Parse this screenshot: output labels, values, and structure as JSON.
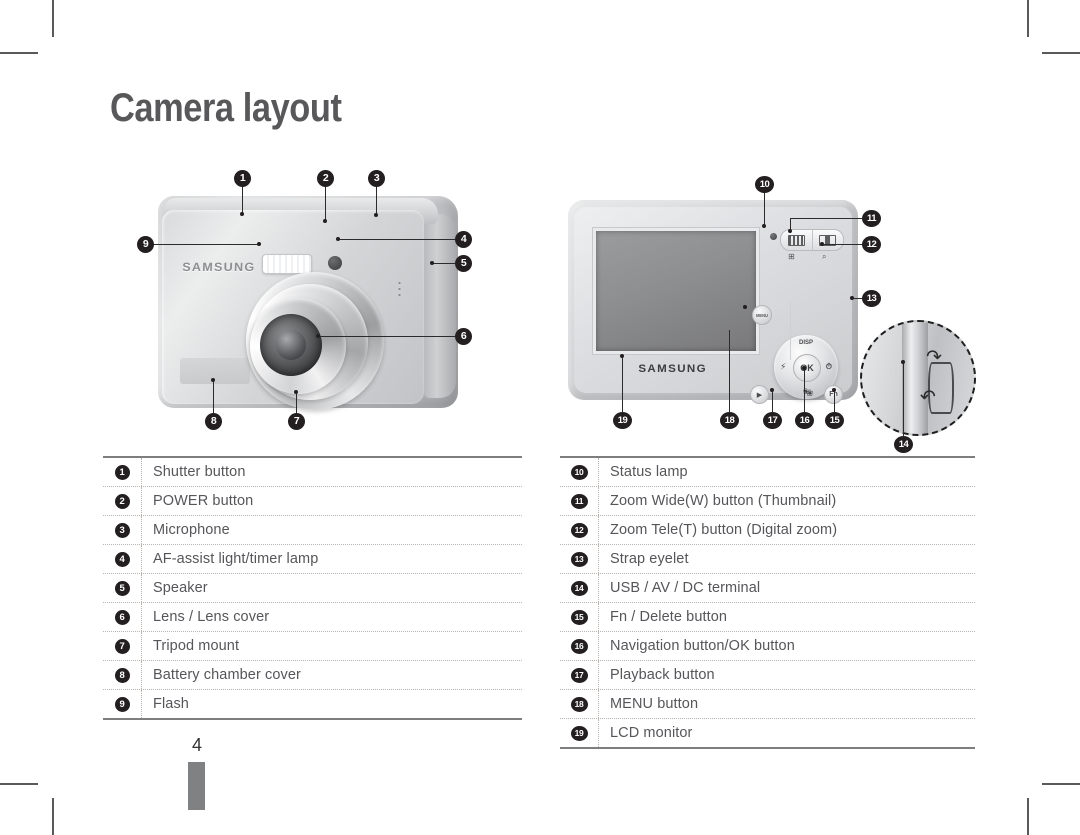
{
  "page": {
    "title": "Camera layout",
    "number": "4"
  },
  "figures": {
    "front": {
      "name": "front-view",
      "brand": "SAMSUNG",
      "callouts": [
        "1",
        "2",
        "3",
        "4",
        "5",
        "6",
        "7",
        "8",
        "9"
      ]
    },
    "back": {
      "name": "back-view",
      "brand": "SAMSUNG",
      "ok_label": "OK",
      "menu_label": "MENU",
      "fn_label": "Fn",
      "disp_label": "DISP",
      "flash_icon": "⚡",
      "timer_icon": "⏱",
      "macro_icon": "❀",
      "playback_icon": "▶",
      "thumbnail_icon": "⊞",
      "magnifier_icon": "⌕",
      "callouts": [
        "10",
        "11",
        "12",
        "13",
        "14",
        "15",
        "16",
        "17",
        "18",
        "19"
      ]
    }
  },
  "tables": {
    "left": [
      {
        "num": "1",
        "label": "Shutter button"
      },
      {
        "num": "2",
        "label": "POWER button"
      },
      {
        "num": "3",
        "label": "Microphone"
      },
      {
        "num": "4",
        "label": "AF-assist light/timer lamp"
      },
      {
        "num": "5",
        "label": "Speaker"
      },
      {
        "num": "6",
        "label": "Lens / Lens cover"
      },
      {
        "num": "7",
        "label": "Tripod mount"
      },
      {
        "num": "8",
        "label": "Battery chamber cover"
      },
      {
        "num": "9",
        "label": "Flash"
      }
    ],
    "right": [
      {
        "num": "10",
        "label": "Status lamp"
      },
      {
        "num": "11",
        "label": "Zoom Wide(W) button (Thumbnail)"
      },
      {
        "num": "12",
        "label": "Zoom Tele(T) button (Digital zoom)"
      },
      {
        "num": "13",
        "label": "Strap eyelet"
      },
      {
        "num": "14",
        "label": "USB / AV / DC terminal"
      },
      {
        "num": "15",
        "label": "Fn / Delete button"
      },
      {
        "num": "16",
        "label": "Navigation button/OK button"
      },
      {
        "num": "17",
        "label": "Playback button"
      },
      {
        "num": "18",
        "label": "MENU button"
      },
      {
        "num": "19",
        "label": "LCD monitor"
      }
    ]
  },
  "colors": {
    "title": "#58585a",
    "text": "#56565a",
    "badge": "#231f20",
    "rule": "#7d7e80"
  }
}
